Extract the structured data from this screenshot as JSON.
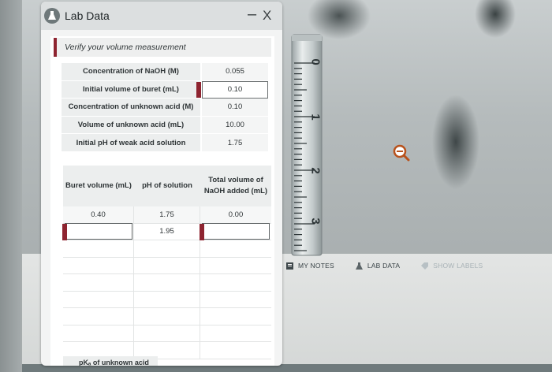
{
  "window": {
    "title": "Lab Data",
    "minimize": "–",
    "close": "X"
  },
  "section_header": "Verify your volume measurement",
  "parameters": [
    {
      "label": "Concentration of NaOH (M)",
      "value": "0.055",
      "editable": false
    },
    {
      "label": "Initial volume of buret (mL)",
      "value": "0.10",
      "editable": true
    },
    {
      "label": "Concentration of unknown acid (M)",
      "value": "0.10",
      "editable": false
    },
    {
      "label": "Volume of unknown acid (mL)",
      "value": "10.00",
      "editable": false
    },
    {
      "label": "Initial pH of weak acid solution",
      "value": "1.75",
      "editable": false
    }
  ],
  "data_table": {
    "headers": [
      "Buret volume (mL)",
      "pH of solution",
      "Total volume of NaOH added (mL)"
    ],
    "rows": [
      [
        "0.40",
        "1.75",
        "0.00"
      ],
      [
        "",
        "1.95",
        ""
      ]
    ]
  },
  "pka_label": "pKₐ of unknown acid",
  "buret_scale": [
    "0",
    "1",
    "2",
    "3"
  ],
  "toolbar": {
    "notes": "MY NOTES",
    "lab_data": "LAB DATA",
    "show_labels": "SHOW LABELS"
  },
  "colors": {
    "accent": "#8e2430",
    "magnifier": "#b8521c"
  },
  "icons": {
    "title": "flask-icon",
    "magnifier": "magnifier-icon",
    "notes": "notes-icon",
    "lab_data": "flask-icon",
    "show_labels": "tag-icon"
  }
}
